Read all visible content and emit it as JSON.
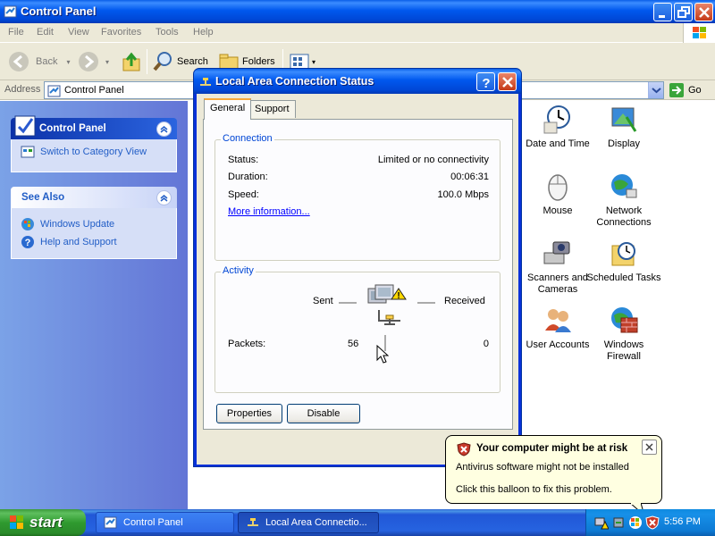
{
  "window": {
    "title": "Control Panel",
    "menu": [
      "File",
      "Edit",
      "View",
      "Favorites",
      "Tools",
      "Help"
    ],
    "toolbar": {
      "back": "Back",
      "search": "Search",
      "folders": "Folders"
    },
    "address": {
      "label": "Address",
      "value": "Control Panel",
      "go": "Go"
    }
  },
  "taskpane": {
    "control_panel": {
      "title": "Control Panel",
      "link": "Switch to Category View"
    },
    "see_also": {
      "title": "See Also",
      "links": [
        "Windows Update",
        "Help and Support"
      ]
    }
  },
  "icons": [
    {
      "label": "Date and Time"
    },
    {
      "label": "Display"
    },
    {
      "label": "Mouse"
    },
    {
      "label": "Network Connections"
    },
    {
      "label": "Scanners and Cameras"
    },
    {
      "label": "Scheduled Tasks"
    },
    {
      "label": "User Accounts"
    },
    {
      "label": "Windows Firewall"
    }
  ],
  "dialog": {
    "title": "Local Area Connection Status",
    "tabs": [
      "General",
      "Support"
    ],
    "connection": {
      "label": "Connection",
      "status_label": "Status:",
      "status_value": "Limited or no connectivity",
      "duration_label": "Duration:",
      "duration_value": "00:06:31",
      "speed_label": "Speed:",
      "speed_value": "100.0 Mbps",
      "more_info": "More information..."
    },
    "activity": {
      "label": "Activity",
      "sent": "Sent",
      "received": "Received",
      "packets_label": "Packets:",
      "packets_sent": "56",
      "packets_received": "0"
    },
    "buttons": {
      "properties": "Properties",
      "disable": "Disable"
    }
  },
  "balloon": {
    "title": "Your computer might be at risk",
    "line1": "Antivirus software might not be installed",
    "line2": "Click this balloon to fix this problem."
  },
  "taskbar": {
    "start": "start",
    "tasks": [
      "Control Panel",
      "Local Area Connectio..."
    ],
    "clock": "5:56 PM"
  },
  "colors": {
    "xp_blue": "#0058ee",
    "start_green": "#2f9a2f",
    "balloon_bg": "#ffffe1",
    "link_blue": "#215dc6"
  }
}
